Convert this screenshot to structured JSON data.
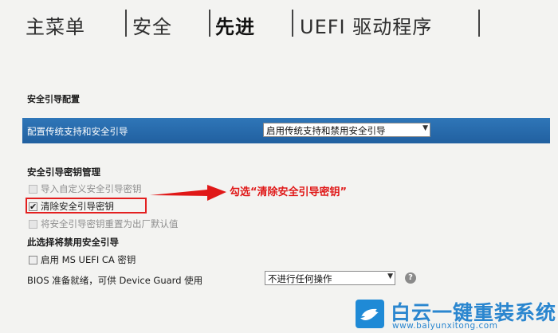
{
  "tabs": [
    {
      "label": "主菜单"
    },
    {
      "label": "安全"
    },
    {
      "label": "先进",
      "active": true
    },
    {
      "label": "UEFI 驱动程序"
    }
  ],
  "section_title": "安全引导配置",
  "config_row": {
    "label": "配置传统支持和安全引导",
    "value": "启用传统支持和禁用安全引导"
  },
  "key_management": {
    "title": "安全引导密钥管理",
    "options": [
      {
        "label": "导入自定义安全引导密钥",
        "checked": false,
        "disabled": true
      },
      {
        "label": "清除安全引导密钥",
        "checked": true,
        "disabled": false
      },
      {
        "label": "将安全引导密钥重置为出厂默认值",
        "checked": false,
        "disabled": true
      }
    ]
  },
  "disable_note": "此选择将禁用安全引导",
  "ms_uefi_ca": {
    "label": "启用 MS UEFI CA 密钥",
    "checked": false
  },
  "device_guard": {
    "label": "BIOS 准备就绪，可供 Device Guard 使用",
    "value": "不进行任何操作"
  },
  "annotation": "勾选“清除安全引导密钥”",
  "watermark": {
    "title": "白云一键重装系统",
    "url": "www.baiyunxitong.com"
  },
  "colors": {
    "accent_blue": "#2468a8",
    "annotation_red": "#e01818",
    "watermark_blue": "#2a86cf"
  }
}
